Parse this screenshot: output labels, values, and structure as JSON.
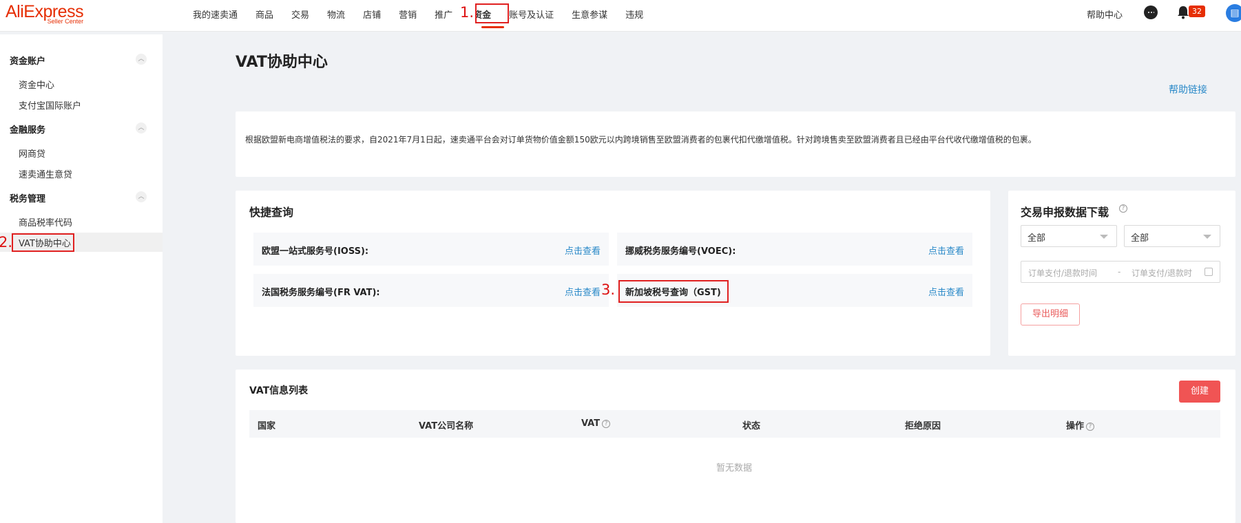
{
  "logo": {
    "main": "AliExpress",
    "sub": "Seller Center"
  },
  "nav": {
    "items": [
      "我的速卖通",
      "商品",
      "交易",
      "物流",
      "店铺",
      "营销",
      "推广",
      "资金",
      "账号及认证",
      "生意参谋",
      "违规"
    ],
    "active": "资金",
    "help_center": "帮助中心",
    "notification_count": "32"
  },
  "annotations": {
    "step1": "1.",
    "step2": "2.",
    "step3": "3."
  },
  "sidebar": {
    "groups": [
      {
        "title": "资金账户",
        "items": [
          "资金中心",
          "支付宝国际账户"
        ]
      },
      {
        "title": "金融服务",
        "items": [
          "网商贷",
          "速卖通生意贷"
        ]
      },
      {
        "title": "税务管理",
        "items": [
          "商品税率代码",
          "VAT协助中心"
        ]
      }
    ],
    "active_item": "VAT协助中心"
  },
  "page": {
    "title": "VAT协助中心",
    "help_link": "帮助链接"
  },
  "notice": {
    "text": "根据欧盟新电商增值税法的要求，自2021年7月1日起，速卖通平台会对订单货物价值金额150欧元以内跨境销售至欧盟消费者的包裹代扣代缴增值税。针对跨境售卖至欧盟消费者且已经由平台代收代缴增值税的包裹。"
  },
  "quick_query": {
    "title": "快捷查询",
    "rows": [
      {
        "label": "欧盟一站式服务号(IOSS):",
        "link": "点击查看"
      },
      {
        "label": "挪威税务服务编号(VOEC):",
        "link": "点击查看"
      },
      {
        "label": "法国税务服务编号(FR VAT):",
        "link": "点击查看"
      },
      {
        "label": "新加坡税号查询（GST)",
        "link": "点击查看"
      }
    ]
  },
  "download": {
    "title": "交易申报数据下载",
    "select1": "全部",
    "select2": "全部",
    "date_start_placeholder": "订单支付/退款时间",
    "date_separator": "-",
    "date_end_placeholder": "订单支付/退款时",
    "export_button": "导出明细"
  },
  "vat_list": {
    "title": "VAT信息列表",
    "create_button": "创建",
    "columns": [
      "国家",
      "VAT公司名称",
      "VAT",
      "状态",
      "拒绝原因",
      "操作"
    ],
    "empty_text": "暂无数据"
  }
}
